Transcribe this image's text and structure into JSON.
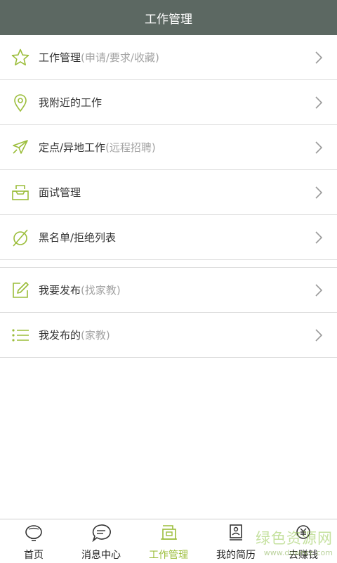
{
  "header": {
    "title": "工作管理"
  },
  "menu": {
    "group1": [
      {
        "label": "工作管理",
        "sub": "(申请/要求/收藏)",
        "icon": "star-icon"
      },
      {
        "label": "我附近的工作",
        "sub": "",
        "icon": "location-pin-icon"
      },
      {
        "label": "定点/异地工作",
        "sub": "(远程招聘)",
        "icon": "airplane-icon"
      },
      {
        "label": "面试管理",
        "sub": "",
        "icon": "inbox-tray-icon"
      },
      {
        "label": "黑名单/拒绝列表",
        "sub": "",
        "icon": "block-icon"
      }
    ],
    "group2": [
      {
        "label": "我要发布",
        "sub": "(找家教)",
        "icon": "edit-icon"
      },
      {
        "label": "我发布的",
        "sub": "(家教)",
        "icon": "list-icon"
      }
    ]
  },
  "tabbar": {
    "items": [
      {
        "label": "首页",
        "icon": "home-lantern-icon",
        "active": false
      },
      {
        "label": "消息中心",
        "icon": "chat-bubble-icon",
        "active": false
      },
      {
        "label": "工作管理",
        "icon": "work-card-icon",
        "active": true
      },
      {
        "label": "我的简历",
        "icon": "resume-icon",
        "active": false
      },
      {
        "label": "去赚钱",
        "icon": "yuan-coin-icon",
        "active": false
      }
    ]
  },
  "watermark": {
    "line1": "绿色资源网",
    "line2": "www.downcc.com"
  },
  "colors": {
    "header_bg": "#5c6862",
    "accent": "#9bbd3a",
    "divider": "#dcdcdc"
  }
}
